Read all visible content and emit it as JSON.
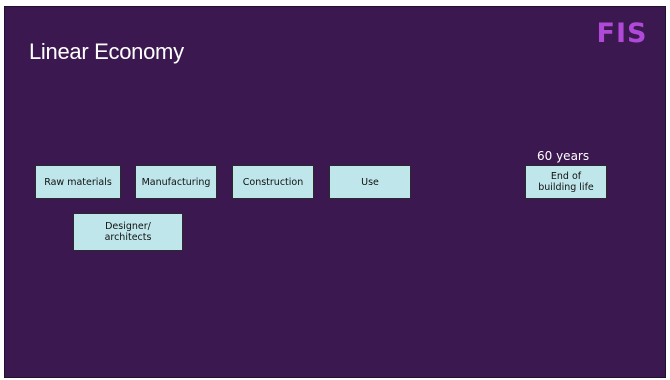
{
  "slide": {
    "title": "Linear Economy",
    "logo_text": "FIS",
    "colors": {
      "background": "#3b1950",
      "box_fill": "#bfe6ea",
      "logo": "#b048d8",
      "title": "#ffffff"
    }
  },
  "diagram": {
    "boxes": [
      {
        "id": "raw",
        "label": "Raw materials"
      },
      {
        "id": "manufacturing",
        "label": "Manufacturing"
      },
      {
        "id": "construction",
        "label": "Construction"
      },
      {
        "id": "use",
        "label": "Use"
      },
      {
        "id": "end",
        "label": "End of\nbuilding life"
      },
      {
        "id": "designer",
        "label": "Designer/\narchitects"
      }
    ],
    "annotation": "60 years"
  }
}
